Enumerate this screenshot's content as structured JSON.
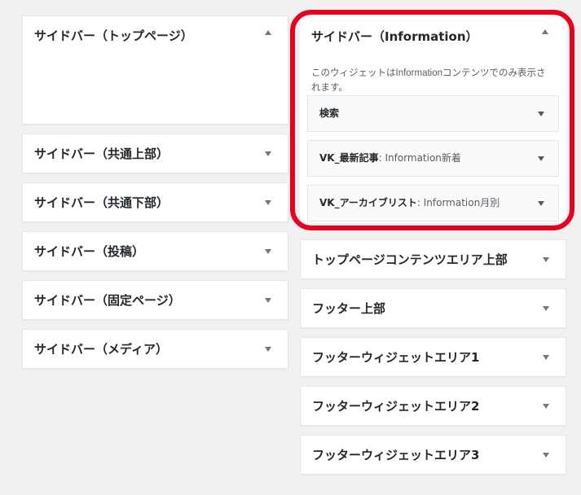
{
  "left_areas": [
    {
      "title": "サイドバー（トップページ）",
      "arrow": "up"
    },
    {
      "title": "サイドバー（共通上部）",
      "arrow": "down"
    },
    {
      "title": "サイドバー（共通下部）",
      "arrow": "down"
    },
    {
      "title": "サイドバー（投稿）",
      "arrow": "down"
    },
    {
      "title": "サイドバー（固定ページ）",
      "arrow": "down"
    },
    {
      "title": "サイドバー（メディア）",
      "arrow": "down"
    }
  ],
  "info_area": {
    "title": "サイドバー（Information）",
    "description": "このウィジェットはInformationコンテンツでのみ表示されます。",
    "widgets": [
      {
        "name": "検索",
        "sub": ""
      },
      {
        "name": "VK_最新記事",
        "sub": ": Information新着"
      },
      {
        "name": "VK_アーカイブリスト",
        "sub": ": Information月別"
      }
    ]
  },
  "right_areas": [
    {
      "title": "トップページコンテンツエリア上部"
    },
    {
      "title": "フッター上部"
    },
    {
      "title": "フッターウィジェットエリア1"
    },
    {
      "title": "フッターウィジェットエリア2"
    },
    {
      "title": "フッターウィジェットエリア3"
    }
  ],
  "colors": {
    "highlight": "#e8001e",
    "background": "#f1f1f1"
  }
}
